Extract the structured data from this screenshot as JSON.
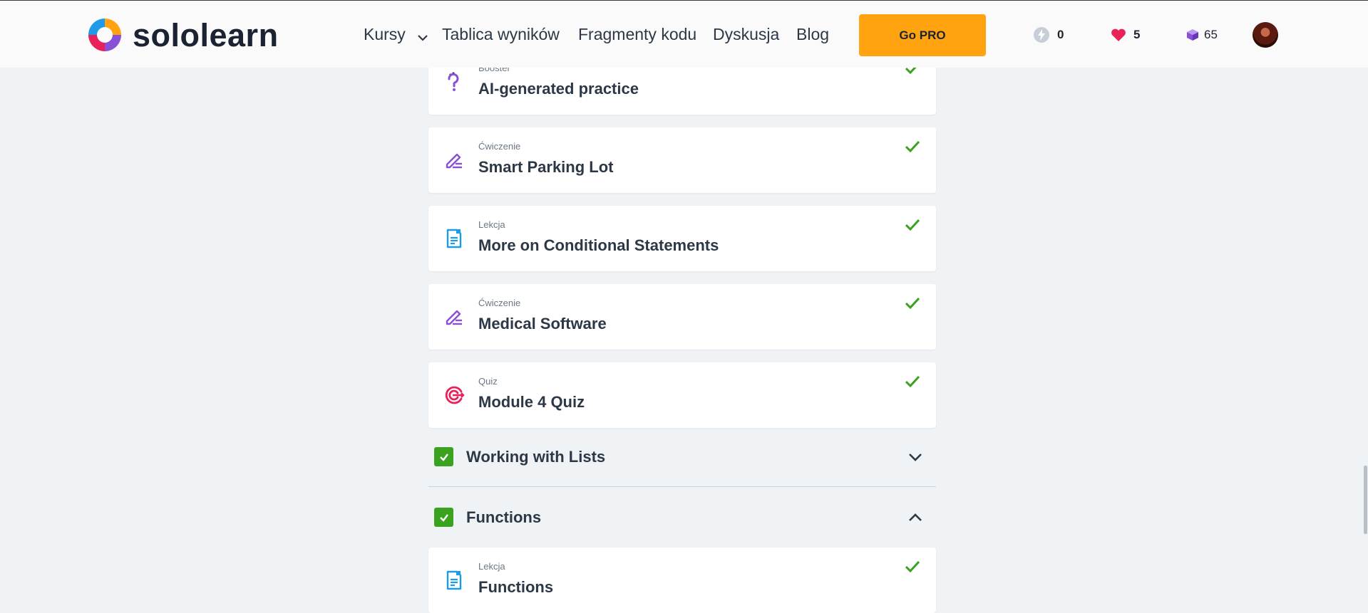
{
  "header": {
    "logo_text": "sololearn",
    "nav": [
      {
        "label": "Kursy",
        "has_dropdown": true
      },
      {
        "label": "Tablica wyników"
      },
      {
        "label": "Fragmenty kodu"
      },
      {
        "label": "Dyskusja"
      },
      {
        "label": "Blog"
      }
    ],
    "go_pro_label": "Go PRO",
    "stats": {
      "streak": {
        "icon": "lightning-icon",
        "value": "0"
      },
      "hearts": {
        "icon": "heart-icon",
        "value": "5"
      },
      "bits": {
        "icon": "cube-icon",
        "value": "65"
      }
    }
  },
  "lessons": [
    {
      "type": "Booster",
      "title": "AI-generated practice",
      "icon": "question-icon",
      "completed": true
    },
    {
      "type": "Ćwiczenie",
      "title": "Smart Parking Lot",
      "icon": "pencil-icon",
      "completed": true
    },
    {
      "type": "Lekcja",
      "title": "More on Conditional Statements",
      "icon": "document-icon",
      "completed": true
    },
    {
      "type": "Ćwiczenie",
      "title": "Medical Software",
      "icon": "pencil-icon",
      "completed": true
    },
    {
      "type": "Quiz",
      "title": "Module 4 Quiz",
      "icon": "target-icon",
      "completed": true
    }
  ],
  "modules": [
    {
      "title": "Working with Lists",
      "completed": true,
      "expanded": false
    },
    {
      "title": "Functions",
      "completed": true,
      "expanded": true
    }
  ],
  "functions_lessons": [
    {
      "type": "Lekcja",
      "title": "Functions",
      "icon": "document-icon",
      "completed": true
    }
  ],
  "colors": {
    "accent_orange": "#ffa310",
    "check_green": "#3aa21e",
    "purple": "#8a4fd8",
    "blue": "#1e9be8",
    "pink": "#e8215a"
  }
}
